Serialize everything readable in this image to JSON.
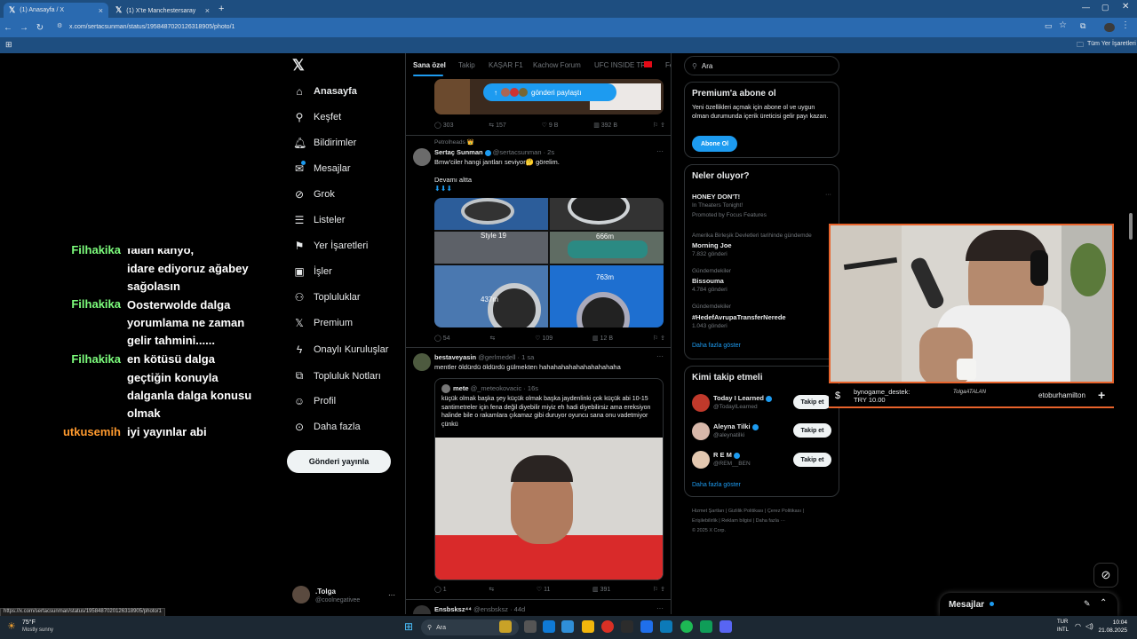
{
  "browser": {
    "tabs": [
      {
        "title": "(1) Anasayfa / X"
      },
      {
        "title": "(1) X'te Manchestersaray ◎ ..."
      }
    ],
    "url": "x.com/sertacsunman/status/1958487020126318905/photo/1",
    "bookmarks_label": "Tüm Yer İşaretleri",
    "status_url": "https://x.com/sertacsunman/status/1958487020126318905/photo/1"
  },
  "chat": {
    "lines": [
      {
        "user": "",
        "text": "falan kahyo,"
      },
      {
        "user": "Filhakika",
        "text": "idare ediyoruz ağabey"
      },
      {
        "user": "",
        "text": "sağolasın"
      },
      {
        "user": "Filhakika",
        "text": "Oosterwolde dalga"
      },
      {
        "user": "",
        "text": "yorumlama ne zaman"
      },
      {
        "user": "",
        "text": "gelir tahmini......"
      },
      {
        "user": "Filhakika",
        "text": "en kötüsü dalga"
      },
      {
        "user": "",
        "text": "geçtiğin konuyla"
      },
      {
        "user": "",
        "text": "dalganla dalga konusu"
      },
      {
        "user": "",
        "text": "olmak"
      },
      {
        "user": "utkusemih",
        "text": "iyi yayınlar abi"
      }
    ],
    "user_color_green": "#7cfc7c",
    "user_color_orange": "#ff9a2e"
  },
  "sidebar": {
    "items": [
      {
        "label": "Anasayfa",
        "icon": "home-icon"
      },
      {
        "label": "Keşfet",
        "icon": "search-icon"
      },
      {
        "label": "Bildirimler",
        "icon": "bell-icon"
      },
      {
        "label": "Mesajlar",
        "icon": "mail-icon"
      },
      {
        "label": "Grok",
        "icon": "grok-icon"
      },
      {
        "label": "Listeler",
        "icon": "list-icon"
      },
      {
        "label": "Yer İşaretleri",
        "icon": "bookmark-icon"
      },
      {
        "label": "İşler",
        "icon": "briefcase-icon"
      },
      {
        "label": "Topluluklar",
        "icon": "people-icon"
      },
      {
        "label": "Premium",
        "icon": "x-icon"
      },
      {
        "label": "Onaylı Kuruluşlar",
        "icon": "lightning-icon"
      },
      {
        "label": "Topluluk Notları",
        "icon": "notes-icon"
      },
      {
        "label": "Profil",
        "icon": "person-icon"
      },
      {
        "label": "Daha fazla",
        "icon": "more-circle-icon"
      }
    ],
    "post_button": "Gönderi yayınla",
    "account_name": ".Tolga",
    "account_handle": "@coolnegativee",
    "account_more": "···"
  },
  "feed": {
    "tabs": [
      "Sana özel",
      "Takip",
      "KAŞAR F1",
      "Kachow Forum",
      "UFC INSIDE TR",
      "Fo"
    ],
    "share_pill": "gönderi paylaştı",
    "post1_stats": [
      "303",
      "157",
      "9 B",
      "392 B"
    ],
    "post2": {
      "context": "Petrolheads",
      "name": "Sertaç Sunman",
      "handle": "@sertacsunman · 2s",
      "text": "Bmw'ciler hangi jantları seviyor🤔 görelim.",
      "text2": "Devamı altta",
      "tags": [
        "Style 19",
        "666m",
        "437m",
        "763m"
      ],
      "stats": [
        "54",
        "",
        "109",
        "12 B"
      ]
    },
    "post3": {
      "name": "bestaveyasin",
      "handle": "@gerlmedell · 1 sa",
      "text": "mentler öldürdü öldürdü gülmekten hahahahahahahahahahaha",
      "quote_name": "mete",
      "quote_handle": "@_meteokovacic · 16s",
      "quote_text": "küçük olmak başka şey küçük olmak başka jaydenlinki çok küçük abi 10-15 santimetreler için fena değil diyebilir miyiz eh hadi diyebilirsiz ama ereksiyon halinde bile o rakamlara çıkamaz gibi duruyor oyuncu sana onu vadetmiyor çünkü",
      "stats": [
        "1",
        "",
        "11",
        "391"
      ]
    },
    "post4": {
      "name": "Ensbsksz⁴⁴",
      "handle": "@ensbsksz · 44d"
    }
  },
  "right": {
    "search_placeholder": "Ara",
    "premium_title": "Premium'a abone ol",
    "premium_text": "Yeni özellikleri açmak için abone ol ve uygun olman durumunda içerik üreticisi gelir payı kazan.",
    "premium_button": "Abone Ol",
    "trends_title": "Neler oluyor?",
    "trends": [
      {
        "ctx": "",
        "name": "HONEY DON'T!",
        "sub": "In Theaters Tonight!",
        "meta": "Promoted by Focus Features"
      },
      {
        "ctx": "Amerika Birleşik Devletleri tarihinde gündemde",
        "name": "Morning Joe",
        "sub": "",
        "meta": "7.832 gönderi"
      },
      {
        "ctx": "Gündemdekiler",
        "name": "Bissouma",
        "sub": "",
        "meta": "4.784 gönderi"
      },
      {
        "ctx": "Gündemdekiler",
        "name": "#HedefAvrupaTransferNerede",
        "sub": "",
        "meta": "1.043 gönderi"
      }
    ],
    "trends_more": "Daha fazla göster",
    "who_title": "Kimi takip etmeli",
    "who": [
      {
        "name": "Today I Learned",
        "handle": "@TodayILearned"
      },
      {
        "name": "Aleyna Tilki",
        "handle": "@aleynatilki"
      },
      {
        "name": "R E M",
        "handle": "@REM__BEN"
      }
    ],
    "follow_label": "Takip et",
    "who_more": "Daha fazla göster",
    "footer": [
      "Hizmet Şartları",
      "Gizlilik Politikası",
      "Çerez Politikası",
      "Erişilebilirlik",
      "Reklam bilgisi",
      "Daha fazla ···",
      "© 2025 X Corp."
    ]
  },
  "stream": {
    "donation_user": "bynogame_destek:",
    "donation_amount": "TRY 10.00",
    "watermark": "TolgaATALAN",
    "follower": "etoburhamilton"
  },
  "messages": {
    "title": "Mesajlar"
  },
  "taskbar": {
    "weather_temp": "75°F",
    "weather_desc": "Mostly sunny",
    "search_placeholder": "Ara",
    "lang": "TUR",
    "lang2": "INTL",
    "time": "10:04",
    "date": "21.08.2025"
  }
}
